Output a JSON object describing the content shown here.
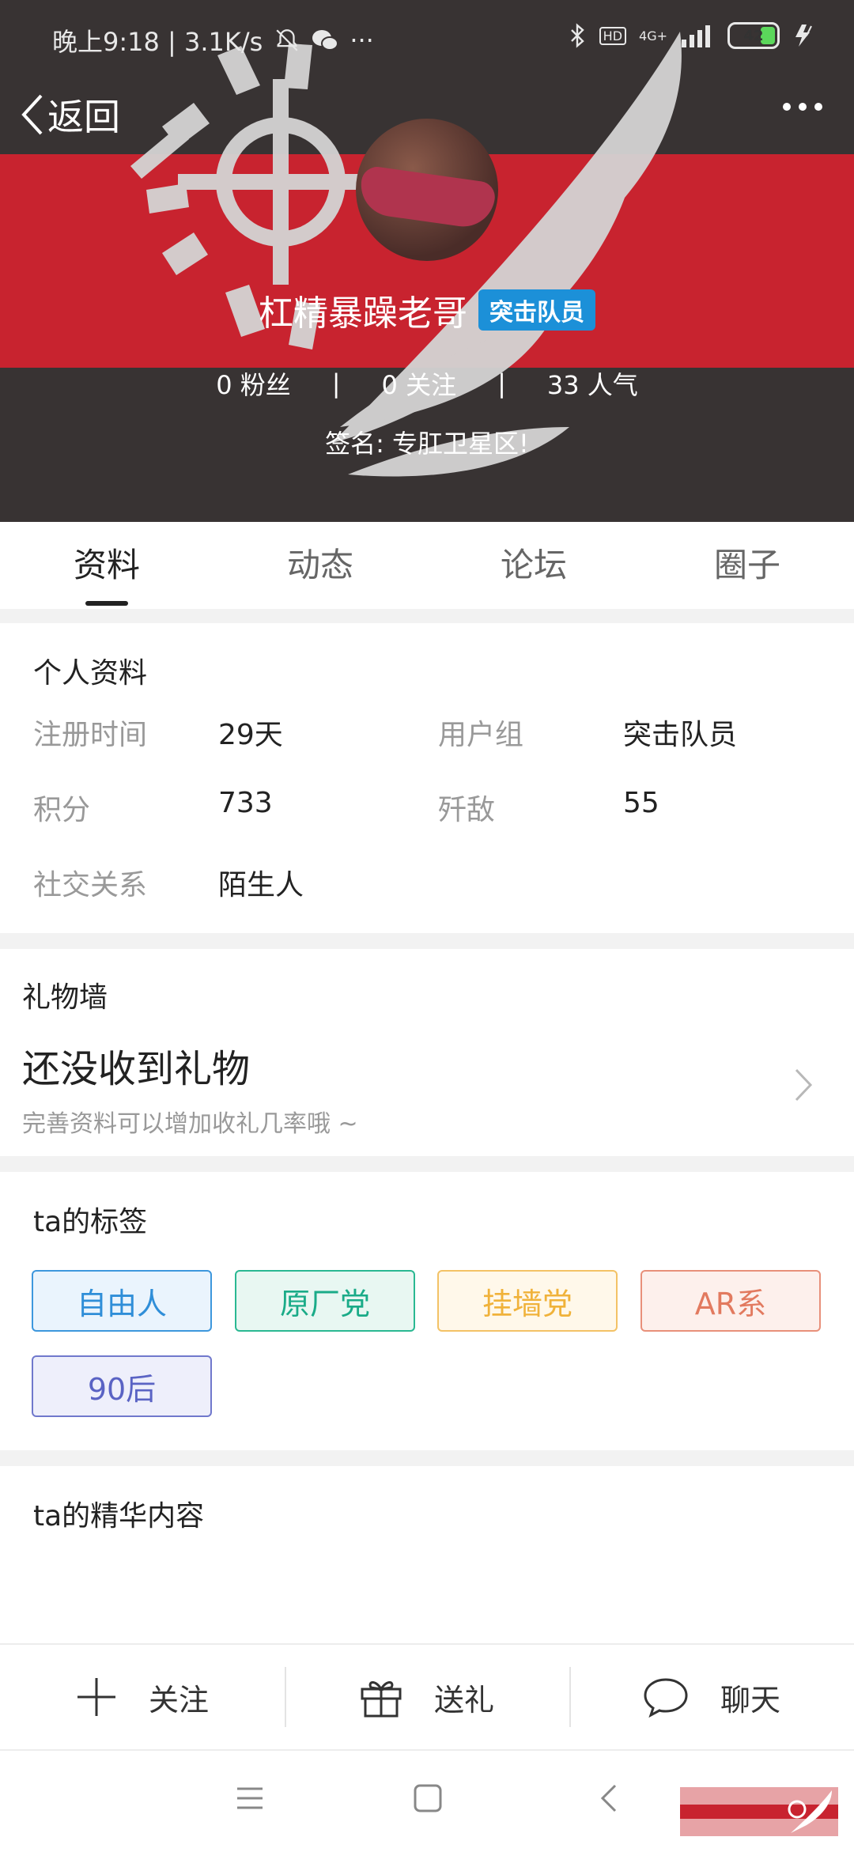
{
  "status_bar": {
    "time_speed": "晚上9:18 | 3.1K/s",
    "more_glyph": "···",
    "hd": "HD",
    "network": "4G+",
    "battery": "42"
  },
  "header": {
    "back_label": "返回",
    "nickname": "杠精暴躁老哥",
    "group_badge": "突击队员",
    "stats": [
      {
        "value": "0",
        "label": "粉丝"
      },
      {
        "value": "0",
        "label": "关注"
      },
      {
        "value": "33",
        "label": "人气"
      }
    ],
    "separator": "|",
    "signature": "签名: 专肛卫星区!"
  },
  "tabs": [
    {
      "label": "资料",
      "active": true
    },
    {
      "label": "动态",
      "active": false
    },
    {
      "label": "论坛",
      "active": false
    },
    {
      "label": "圈子",
      "active": false
    }
  ],
  "profile": {
    "title": "个人资料",
    "fields": [
      {
        "label": "注册时间",
        "value": "29天"
      },
      {
        "label": "用户组",
        "value": "突击队员"
      },
      {
        "label": "积分",
        "value": "733"
      },
      {
        "label": "歼敌",
        "value": "55"
      },
      {
        "label": "社交关系",
        "value": "陌生人"
      }
    ]
  },
  "gift_wall": {
    "title": "礼物墙",
    "empty_text": "还没收到礼物",
    "hint": "完善资料可以增加收礼几率哦 ~"
  },
  "tags_section": {
    "title": "ta的标签",
    "tags": [
      {
        "label": "自由人",
        "color": "#2f8ed8",
        "bg": "#eaf4fd",
        "border": "#3d97dd"
      },
      {
        "label": "原厂党",
        "color": "#1aab88",
        "bg": "#e8f7f2",
        "border": "#2ab892"
      },
      {
        "label": "挂墙党",
        "color": "#f0b23a",
        "bg": "#fff8ea",
        "border": "#f3c266"
      },
      {
        "label": "AR系",
        "color": "#e27a5f",
        "bg": "#fdf0ec",
        "border": "#e8907a"
      },
      {
        "label": "90后",
        "color": "#5a63c4",
        "bg": "#eeeffb",
        "border": "#7078cc"
      }
    ]
  },
  "featured": {
    "title": "ta的精华内容"
  },
  "action_bar": {
    "follow": "关注",
    "gift": "送礼",
    "chat": "聊天"
  },
  "colors": {
    "header_bg": "#383333",
    "header_red": "#c8232f",
    "badge_blue": "#1c90d8"
  }
}
